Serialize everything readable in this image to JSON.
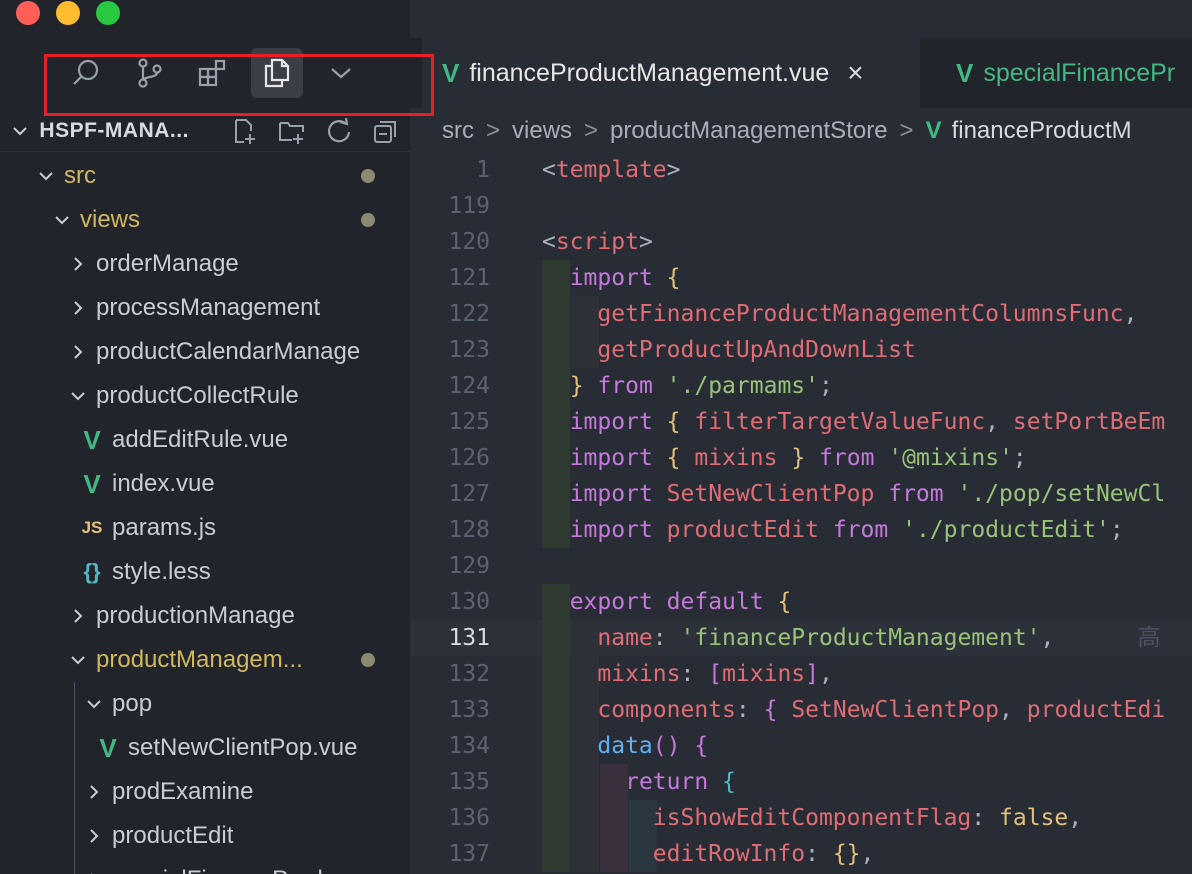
{
  "explorer": {
    "title": "HSPF-MANA...",
    "tree": [
      {
        "label": "src",
        "type": "folder-open",
        "level": 0,
        "modified": true
      },
      {
        "label": "views",
        "type": "folder-open",
        "level": 1,
        "modified": true
      },
      {
        "label": "orderManage",
        "type": "folder",
        "level": 2
      },
      {
        "label": "processManagement",
        "type": "folder",
        "level": 2
      },
      {
        "label": "productCalendarManage",
        "type": "folder",
        "level": 2
      },
      {
        "label": "productCollectRule",
        "type": "folder-open",
        "level": 2
      },
      {
        "label": "addEditRule.vue",
        "type": "vue",
        "level": 3
      },
      {
        "label": "index.vue",
        "type": "vue",
        "level": 3
      },
      {
        "label": "params.js",
        "type": "js",
        "level": 3
      },
      {
        "label": "style.less",
        "type": "less",
        "level": 3
      },
      {
        "label": "productionManage",
        "type": "folder",
        "level": 2
      },
      {
        "label": "productManagem...",
        "type": "folder-open",
        "level": 2,
        "modified": true
      },
      {
        "label": "pop",
        "type": "folder-open",
        "level": 3
      },
      {
        "label": "setNewClientPop.vue",
        "type": "vue",
        "level": 4
      },
      {
        "label": "prodExamine",
        "type": "folder",
        "level": 3
      },
      {
        "label": "productEdit",
        "type": "folder",
        "level": 3
      },
      {
        "label": "specialFinanceProduc",
        "type": "folder",
        "level": 3
      }
    ],
    "file_icon_text": {
      "vue": "V",
      "js": "JS",
      "less": "{}"
    }
  },
  "tabs": {
    "active": "financeProductManagement.vue",
    "active_close": "×",
    "inactive": "specialFinancePr"
  },
  "breadcrumb": {
    "parts": [
      "src",
      "views",
      "productManagementStore",
      "financeProductM"
    ],
    "separator": ">"
  },
  "code": {
    "lines": [
      {
        "n": "1",
        "html": "<span class='punc'>&lt;</span><span class='tag'>template</span><span class='punc'>&gt;</span>"
      },
      {
        "n": "119",
        "html": ""
      },
      {
        "n": "120",
        "html": "<span class='punc'>&lt;</span><span class='tag'>script</span><span class='punc'>&gt;</span>"
      },
      {
        "n": "121",
        "html": "  <span class='kw'>import</span> <span class='brace'>{</span>"
      },
      {
        "n": "122",
        "html": "    <span class='red'>getFinanceProductManagementColumnsFunc</span><span class='punc'>,</span>"
      },
      {
        "n": "123",
        "html": "    <span class='red'>getProductUpAndDownList</span>"
      },
      {
        "n": "124",
        "html": "  <span class='brace'>}</span> <span class='kw'>from</span> <span class='str'>'./parmams'</span><span class='punc'>;</span>"
      },
      {
        "n": "125",
        "html": "  <span class='kw'>import</span> <span class='brace'>{</span> <span class='red'>filterTargetValueFunc</span><span class='punc'>,</span> <span class='red'>setPortBeEm</span>"
      },
      {
        "n": "126",
        "html": "  <span class='kw'>import</span> <span class='brace'>{</span> <span class='red'>mixins</span> <span class='brace'>}</span> <span class='kw'>from</span> <span class='str'>'@mixins'</span><span class='punc'>;</span>"
      },
      {
        "n": "127",
        "html": "  <span class='kw'>import</span> <span class='red'>SetNewClientPop</span> <span class='kw'>from</span> <span class='str'>'./pop/setNewCl</span>"
      },
      {
        "n": "128",
        "html": "  <span class='kw'>import</span> <span class='red'>productEdit</span> <span class='kw'>from</span> <span class='str'>'./productEdit'</span><span class='punc'>;</span>"
      },
      {
        "n": "129",
        "html": ""
      },
      {
        "n": "130",
        "html": "  <span class='kw'>export</span> <span class='kw'>default</span> <span class='brace'>{</span>"
      },
      {
        "n": "131",
        "html": "    <span class='red'>name</span><span class='punc'>:</span> <span class='str'>'financeProductManagement'</span><span class='punc'>,</span>      <span class='ghost'>高</span>",
        "current": true
      },
      {
        "n": "132",
        "html": "    <span class='red'>mixins</span><span class='punc'>:</span> <span class='brace2'>[</span><span class='red'>mixins</span><span class='brace2'>]</span><span class='punc'>,</span>"
      },
      {
        "n": "133",
        "html": "    <span class='red'>components</span><span class='punc'>:</span> <span class='brace2'>{</span> <span class='red'>SetNewClientPop</span><span class='punc'>,</span> <span class='red'>productEdi</span>"
      },
      {
        "n": "134",
        "html": "    <span class='fn'>data</span><span class='brace2'>()</span> <span class='brace2'>{</span>"
      },
      {
        "n": "135",
        "html": "      <span class='kw'>return</span> <span class='brace3'>{</span>"
      },
      {
        "n": "136",
        "html": "        <span class='red'>isShowEditComponentFlag</span><span class='punc'>:</span> <span class='bool'>false</span><span class='punc'>,</span>"
      },
      {
        "n": "137",
        "html": "        <span class='red'>editRowInfo</span><span class='punc'>:</span> <span class='brace'>{}</span><span class='punc'>,</span>"
      }
    ]
  }
}
